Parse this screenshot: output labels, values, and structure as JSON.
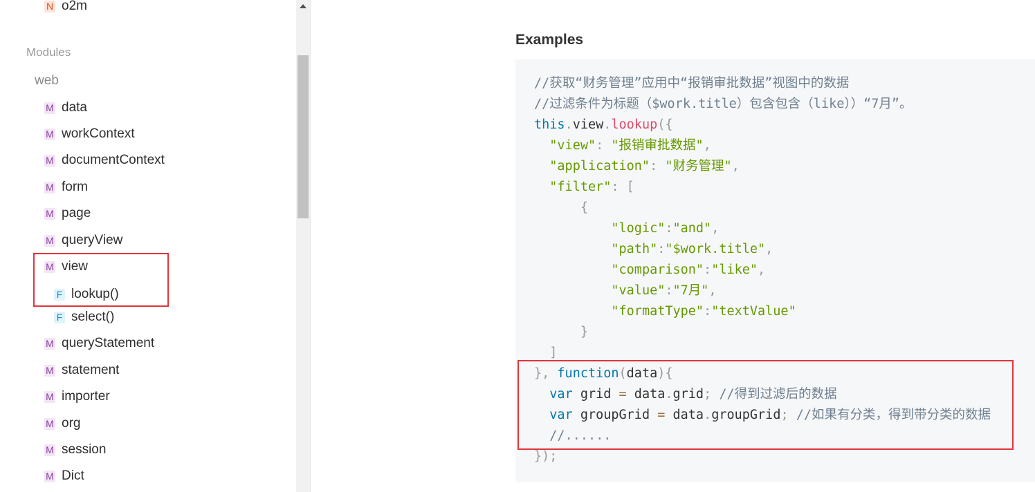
{
  "sidebar": {
    "top_item": {
      "badge": "N",
      "label": "o2m"
    },
    "section_title": "Modules",
    "group_title": "web",
    "items": [
      {
        "badge": "M",
        "label": "data"
      },
      {
        "badge": "M",
        "label": "workContext"
      },
      {
        "badge": "M",
        "label": "documentContext"
      },
      {
        "badge": "M",
        "label": "form"
      },
      {
        "badge": "M",
        "label": "page"
      },
      {
        "badge": "M",
        "label": "queryView"
      },
      {
        "badge": "M",
        "label": "view"
      },
      {
        "badge": "F",
        "label": "lookup()"
      },
      {
        "badge": "F",
        "label": "select()"
      },
      {
        "badge": "M",
        "label": "queryStatement"
      },
      {
        "badge": "M",
        "label": "statement"
      },
      {
        "badge": "M",
        "label": "importer"
      },
      {
        "badge": "M",
        "label": "org"
      },
      {
        "badge": "M",
        "label": "session"
      },
      {
        "badge": "M",
        "label": "Dict"
      }
    ]
  },
  "main": {
    "examples_title": "Examples",
    "code_lines": [
      "//获取“财务管理”应用中“报销审批数据”视图中的数据",
      "//过滤条件为标题（$work.title）包含包含（like））“7月”。",
      "this.view.lookup({",
      "  \"view\": \"报销审批数据\",",
      "  \"application\": \"财务管理\",",
      "  \"filter\": [",
      "      {",
      "          \"logic\":\"and\",",
      "          \"path\":\"$work.title\",",
      "          \"comparison\":\"like\",",
      "          \"value\":\"7月\",",
      "          \"formatType\":\"textValue\"",
      "      }",
      "  ]",
      "}, function(data){",
      "  var grid = data.grid; //得到过滤后的数据",
      "  var groupGrid = data.groupGrid; //如果有分类，得到带分类的数据",
      "  //......",
      "});"
    ]
  },
  "colors": {
    "highlight_border": "#e0343b",
    "code_background": "#f6f7f9",
    "comment": "#708090",
    "keyword": "#0077aa",
    "string": "#669900",
    "function": "#dd4a68"
  }
}
